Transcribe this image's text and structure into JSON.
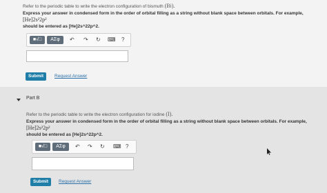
{
  "part_a": {
    "prompt_text": "Refer to the periodic table to write the electron configuration of bismuth",
    "element_symbol": "(Bi).",
    "instruction_text": "Express your answer in condensed form in the order of orbital filling as a string without blank space between orbitals. For example,",
    "example_math": "[He]2s²2p²",
    "entry_hint": "should be entered as [He]2s^22p^2.",
    "toolbar": {
      "templates": "■√□",
      "greek": "ΑΣφ",
      "undo": "↶",
      "redo": "↷",
      "reset": "↻",
      "keyboard": "⌨",
      "help": "?"
    },
    "answer_value": "",
    "submit_label": "Submit",
    "request_answer_label": "Request Answer"
  },
  "part_b": {
    "part_title": "Part B",
    "prompt_text": "Refer to the periodic table to write the electron configuration for iodine",
    "element_symbol": "(I).",
    "instruction_text": "Express your answer in condensed form in the order of orbital filling as a string without blank space between orbitals. For example,",
    "example_math": "[He]2s²2p²",
    "entry_hint": "should be entered as [He]2s^22p^2.",
    "toolbar": {
      "templates": "■√□",
      "greek": "ΑΣφ",
      "undo": "↶",
      "redo": "↷",
      "reset": "↻",
      "keyboard": "⌨",
      "help": "?"
    },
    "answer_value": "",
    "submit_label": "Submit",
    "request_answer_label": "Request Answer"
  },
  "colors": {
    "submit": "#1f7ea8",
    "link": "#2a6fa8",
    "toolbar_button": "#5f6d7a"
  }
}
